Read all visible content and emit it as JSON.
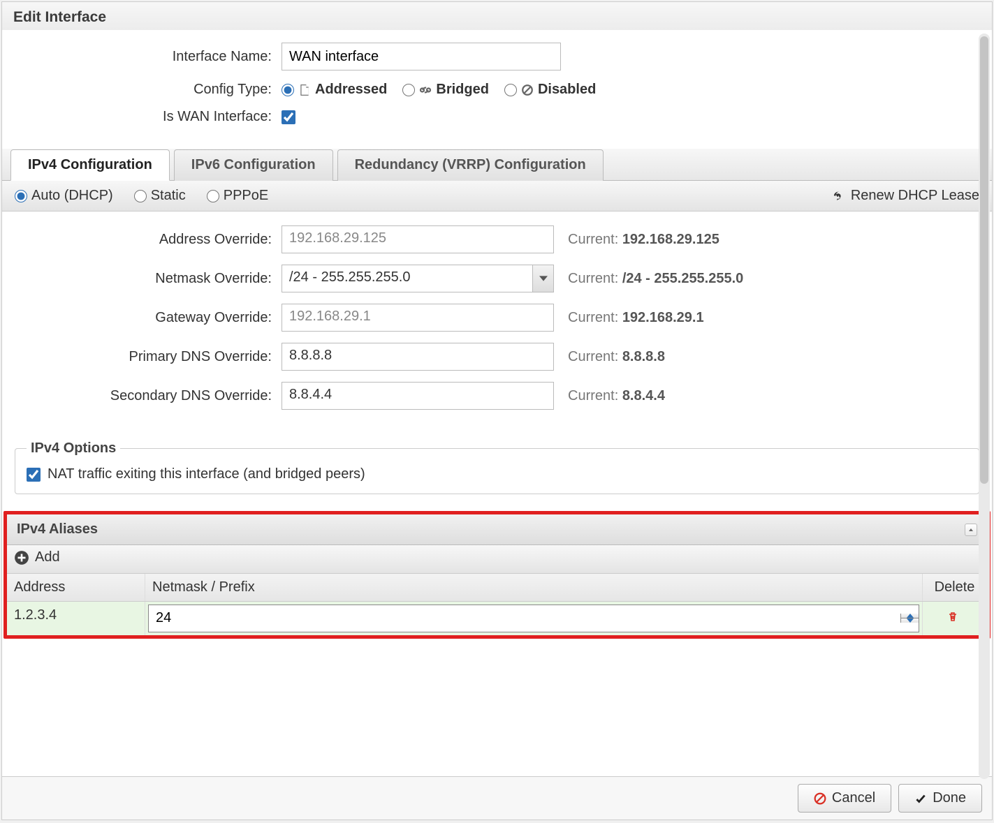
{
  "dialog": {
    "title": "Edit Interface"
  },
  "form": {
    "interfaceName": {
      "label": "Interface Name:",
      "value": "WAN interface"
    },
    "configType": {
      "label": "Config Type:",
      "options": [
        {
          "label": "Addressed",
          "checked": true
        },
        {
          "label": "Bridged",
          "checked": false
        },
        {
          "label": "Disabled",
          "checked": false
        }
      ]
    },
    "isWan": {
      "label": "Is WAN Interface:",
      "checked": true
    }
  },
  "tabs": [
    {
      "label": "IPv4 Configuration",
      "active": true
    },
    {
      "label": "IPv6 Configuration",
      "active": false
    },
    {
      "label": "Redundancy (VRRP) Configuration",
      "active": false
    }
  ],
  "ipv4": {
    "modes": [
      {
        "label": "Auto (DHCP)",
        "checked": true
      },
      {
        "label": "Static",
        "checked": false
      },
      {
        "label": "PPPoE",
        "checked": false
      }
    ],
    "renewLabel": "Renew DHCP Lease",
    "fields": {
      "addressOverride": {
        "label": "Address Override:",
        "value": "192.168.29.125",
        "currentLabel": "Current:",
        "current": "192.168.29.125"
      },
      "netmaskOverride": {
        "label": "Netmask Override:",
        "value": "/24 - 255.255.255.0",
        "currentLabel": "Current:",
        "current": "/24 - 255.255.255.0"
      },
      "gatewayOverride": {
        "label": "Gateway Override:",
        "value": "192.168.29.1",
        "currentLabel": "Current:",
        "current": "192.168.29.1"
      },
      "primaryDns": {
        "label": "Primary DNS Override:",
        "value": "8.8.8.8",
        "currentLabel": "Current:",
        "current": "8.8.8.8"
      },
      "secondaryDns": {
        "label": "Secondary DNS Override:",
        "value": "8.8.4.4",
        "currentLabel": "Current:",
        "current": "8.8.4.4"
      }
    },
    "optionsTitle": "IPv4 Options",
    "natLabel": "NAT traffic exiting this interface (and bridged peers)",
    "natChecked": true
  },
  "aliases": {
    "title": "IPv4 Aliases",
    "addLabel": "Add",
    "columns": {
      "address": "Address",
      "netmask": "Netmask / Prefix",
      "del": "Delete"
    },
    "rows": [
      {
        "address": "1.2.3.4",
        "netmask": "24"
      }
    ]
  },
  "footer": {
    "cancel": "Cancel",
    "done": "Done"
  }
}
